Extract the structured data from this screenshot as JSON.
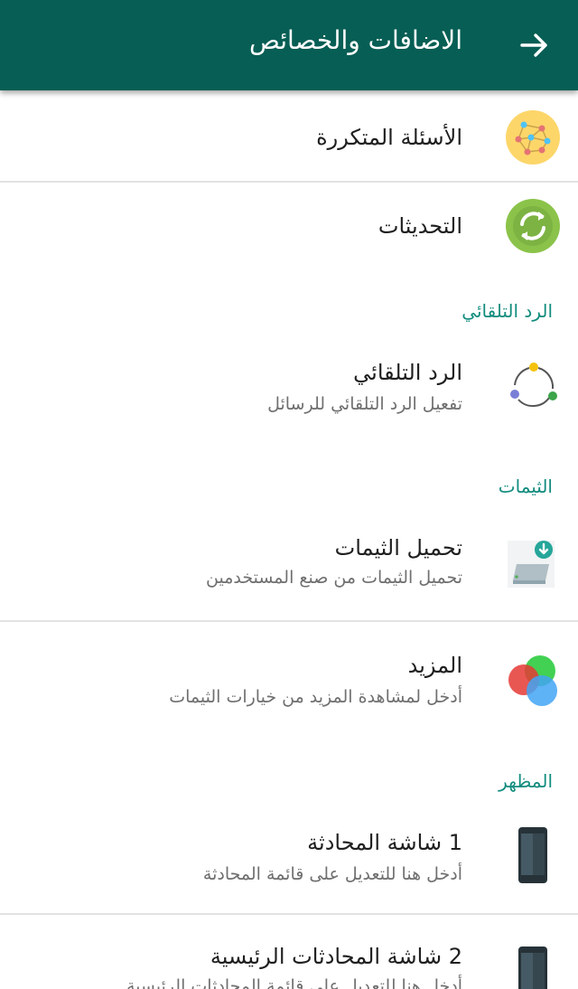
{
  "appbar": {
    "title": "الاضافات والخصائص",
    "back_icon": "arrow-icon"
  },
  "items": {
    "faq": {
      "title": "الأسئلة المتكررة",
      "icon": "network-icon"
    },
    "updates": {
      "title": "التحديثات",
      "icon": "refresh-icon"
    },
    "auto_reply": {
      "title": "الرد التلقائي",
      "subtitle": "تفعيل الرد التلقائي للرسائل",
      "icon": "auto-reply-icon"
    },
    "themes_download": {
      "title": "تحميل الثيمات",
      "subtitle": "تحميل الثيمات من صنع المستخدمين",
      "icon": "download-icon"
    },
    "more": {
      "title": "المزيد",
      "subtitle": "أدخل لمشاهدة المزيد من خيارات الثيمات",
      "icon": "color-circles-icon"
    },
    "chat_screen": {
      "title": "1 شاشة المحادثة",
      "subtitle": "أدخل هنا للتعديل على قائمة المحادثة",
      "icon": "phone-icon"
    },
    "main_chats_screen": {
      "title": "2 شاشة المحادثات الرئيسية",
      "subtitle": "أدخل هنا للتعديل على قائمة المحادثات الرئيسية",
      "icon": "phone-icon"
    }
  },
  "sections": {
    "auto_reply": "الرد التلقائي",
    "themes": "الثيمات",
    "appearance": "المظهر"
  },
  "colors": {
    "appbar": "#075e54",
    "section_header": "#128c7e",
    "updates_icon": "#8bc34a",
    "faq_icon_bg": "#fdd66a"
  }
}
